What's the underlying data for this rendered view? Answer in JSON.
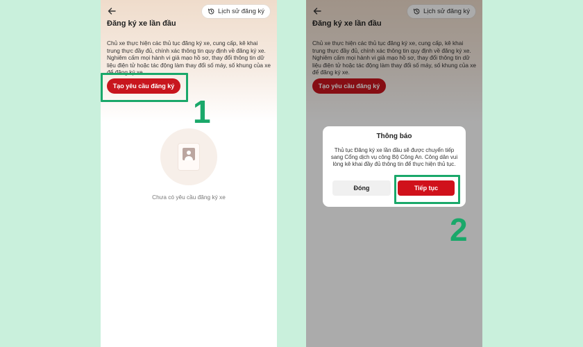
{
  "screen_left": {
    "back_label": "",
    "history_button": "Lịch sử đăng ký",
    "title": "Đăng ký xe lần đầu",
    "description": "Chủ xe thực hiện các thủ tục đăng ký xe, cung cấp, kê khai trung thực đầy đủ, chính xác thông tin quy định về đăng ký xe. Nghiêm cấm mọi hành vi giả mạo hồ sơ, thay đổi thông tin dữ liệu điện tử hoặc tác động làm thay đổi số máy, số khung của xe để đăng ký xe.",
    "create_button": "Tạo yêu cầu đăng ký",
    "empty_state_text": "Chưa có yêu cầu đăng ký xe",
    "step_label": "1"
  },
  "screen_right": {
    "history_button": "Lịch sử đăng ký",
    "title": "Đăng ký xe lần đầu",
    "description": "Chủ xe thực hiện các thủ tục đăng ký xe, cung cấp, kê khai trung thực đầy đủ, chính xác thông tin quy định về đăng ký xe. Nghiêm cấm mọi hành vi giả mạo hồ sơ, thay đổi thông tin dữ liệu điện tử hoặc tác động làm thay đổi số máy, số khung của xe để đăng ký xe.",
    "create_button": "Tạo yêu cầu đăng ký",
    "dialog": {
      "title": "Thông báo",
      "message": "Thủ tục Đăng ký xe lần đầu sẽ được chuyển tiếp sang Cổng dịch vụ công Bộ Công An. Công dân vui lòng kê khai đầy đủ thông tin để thực hiện thủ tục.",
      "close_button": "Đóng",
      "continue_button": "Tiếp tục"
    },
    "step_label": "2"
  },
  "colors": {
    "accent_red": "#c8161e",
    "highlight_green": "#1aa86a",
    "background_mint": "#c9f0dc"
  },
  "icons": {
    "back": "arrow-left-icon",
    "history": "clock-history-icon",
    "empty": "document-user-icon"
  }
}
